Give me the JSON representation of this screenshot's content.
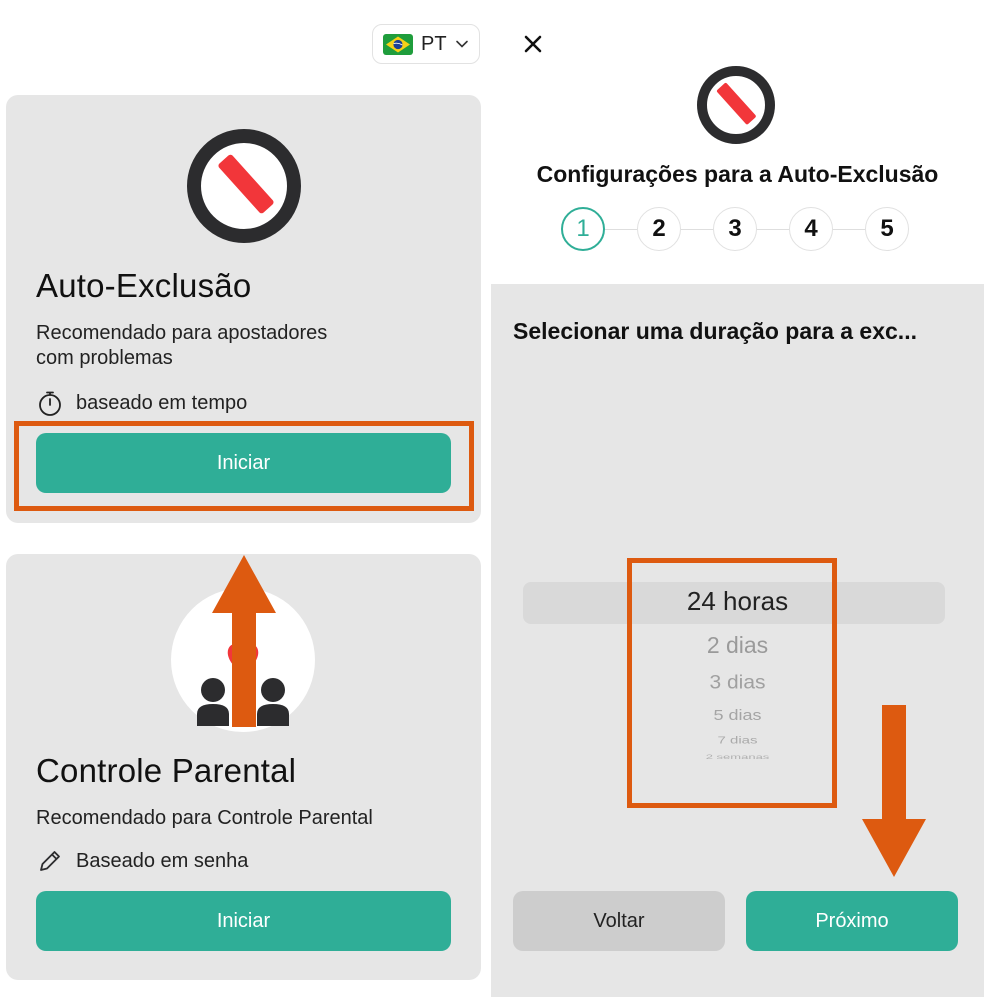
{
  "colors": {
    "accent": "#2fae97",
    "card_bg": "#e6e6e6",
    "annotation": "#dd5a10",
    "stop_red": "#f2363a",
    "ring_dark": "#2c2c2e"
  },
  "left": {
    "language": {
      "flag_icon": "brazil-flag-icon",
      "code": "PT"
    },
    "self_exclusion": {
      "icon": "stop-icon",
      "title": "Auto-Exclusão",
      "description_line1": "Recomendado para apostadores",
      "description_line2": "com problemas",
      "meta_icon": "stopwatch-icon",
      "meta": "baseado em tempo",
      "button": "Iniciar"
    },
    "parental_control": {
      "icon": "family-heart-icon",
      "title": "Controle Parental",
      "description": "Recomendado para Controle Parental",
      "meta_icon": "pencil-icon",
      "meta": "Baseado em senha",
      "button": "Iniciar"
    }
  },
  "right": {
    "close_icon": "close-icon",
    "header_icon": "stop-icon",
    "title": "Configurações para a Auto-Exclusão",
    "steps": [
      "1",
      "2",
      "3",
      "4",
      "5"
    ],
    "active_step": "1",
    "prompt": "Selecionar uma duração para a exc...",
    "picker": {
      "selected": "24 horas",
      "options": [
        "24 horas",
        "2 dias",
        "3 dias",
        "5 dias",
        "7 dias",
        "2 semanas"
      ]
    },
    "back_button": "Voltar",
    "next_button": "Próximo"
  }
}
